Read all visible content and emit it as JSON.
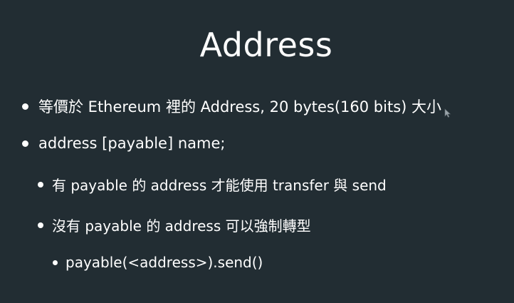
{
  "slide": {
    "title": "Address",
    "bullets": [
      {
        "text": "等價於 Ethereum 裡的 Address, 20 bytes(160 bits) 大小"
      },
      {
        "text": "address [payable] name;"
      },
      {
        "text": "有 payable 的 address 才能使用 transfer 與 send"
      },
      {
        "text": "沒有 payable 的 address 可以強制轉型"
      },
      {
        "text": "payable(<address>).send()"
      }
    ]
  },
  "colors": {
    "background": "#222d33",
    "text": "#ffffff"
  },
  "icons": {
    "cursor": "mouse-pointer-icon"
  }
}
